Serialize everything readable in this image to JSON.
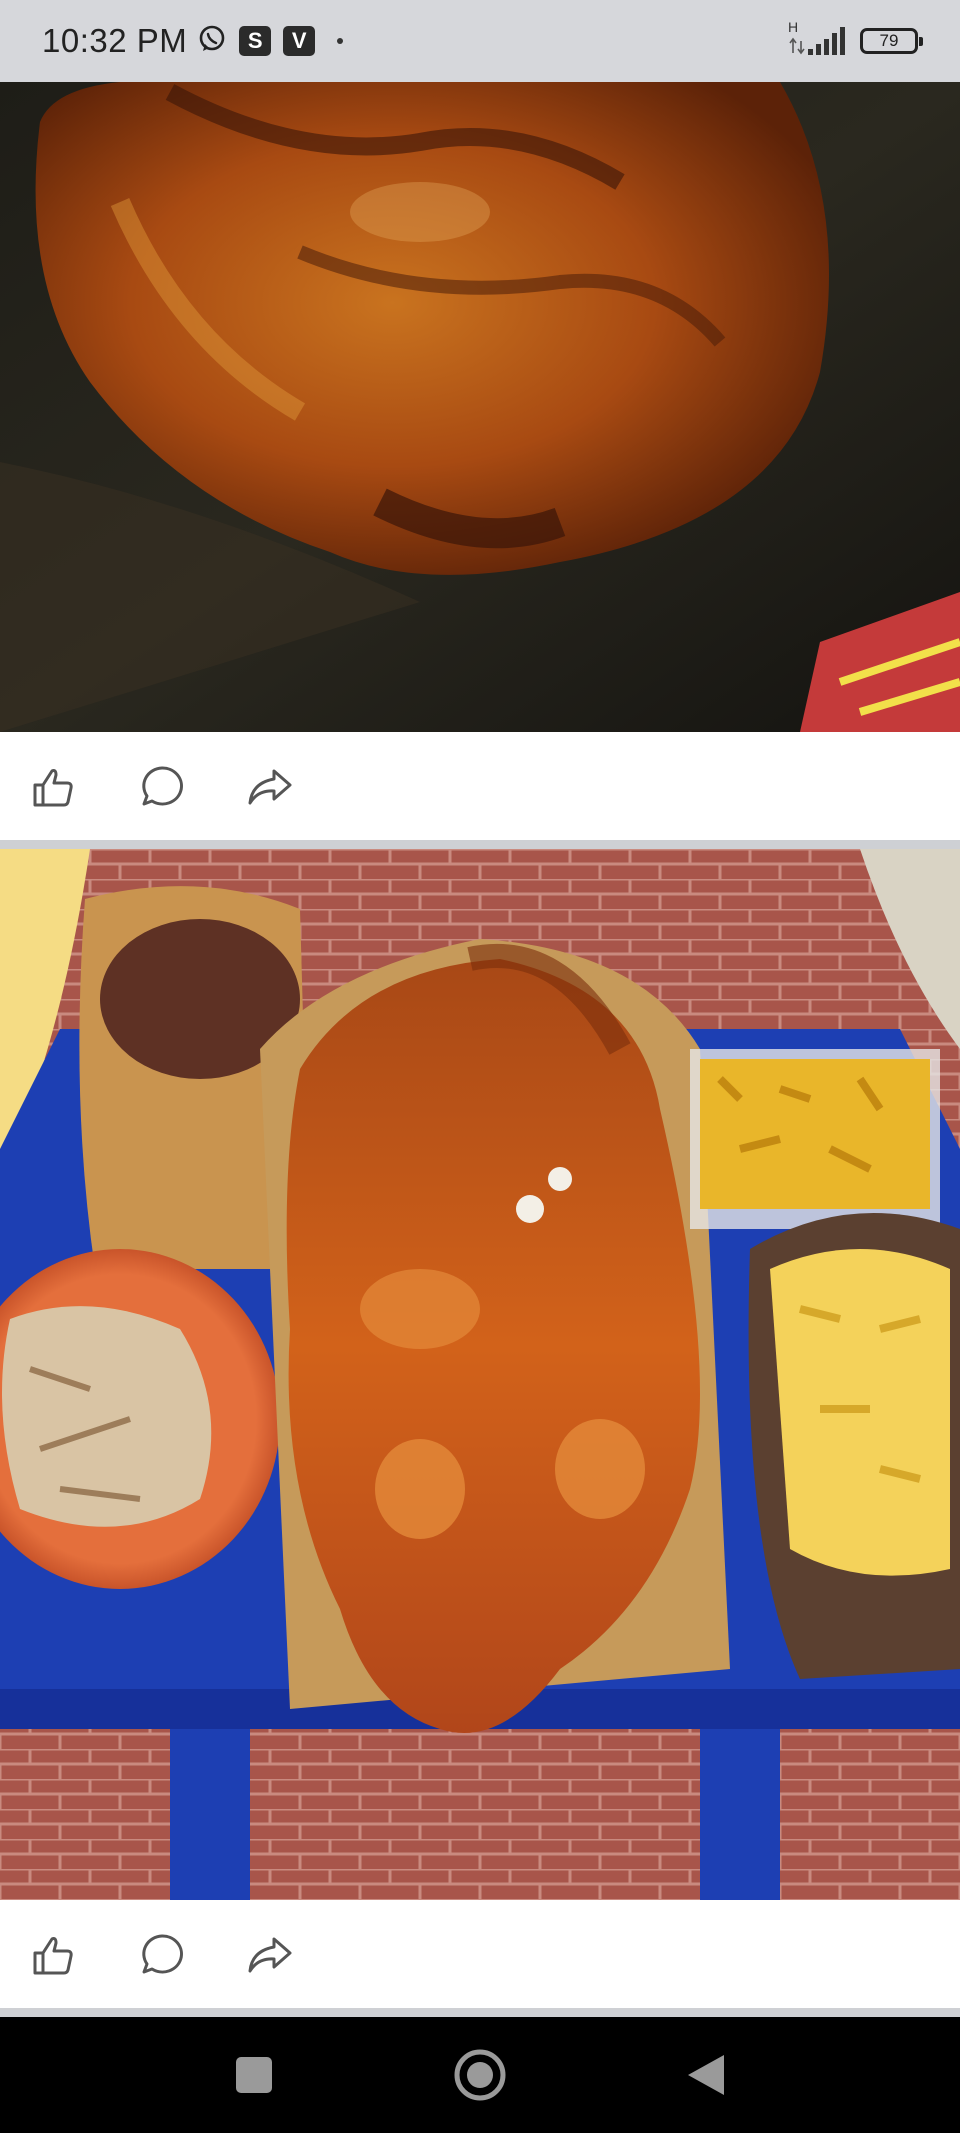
{
  "status_bar": {
    "time": "10:32 PM",
    "app_icons": [
      "whatsapp-icon",
      "s-app-icon",
      "v-app-icon"
    ],
    "badge_s": "S",
    "badge_v": "V",
    "network_label": "H",
    "battery_level": "79"
  },
  "feed": {
    "posts": [
      {
        "image": "roast-meat-closeup",
        "actions": [
          "like",
          "comment",
          "share"
        ]
      },
      {
        "image": "roast-pig-feast",
        "actions": [
          "like",
          "comment",
          "share"
        ]
      }
    ]
  },
  "nav": {
    "buttons": [
      "recents",
      "home",
      "back"
    ]
  },
  "colors": {
    "status_bg": "#d6d7db",
    "separator": "#ced0d4",
    "icon_stroke": "#555555",
    "nav_bg": "#000000"
  }
}
